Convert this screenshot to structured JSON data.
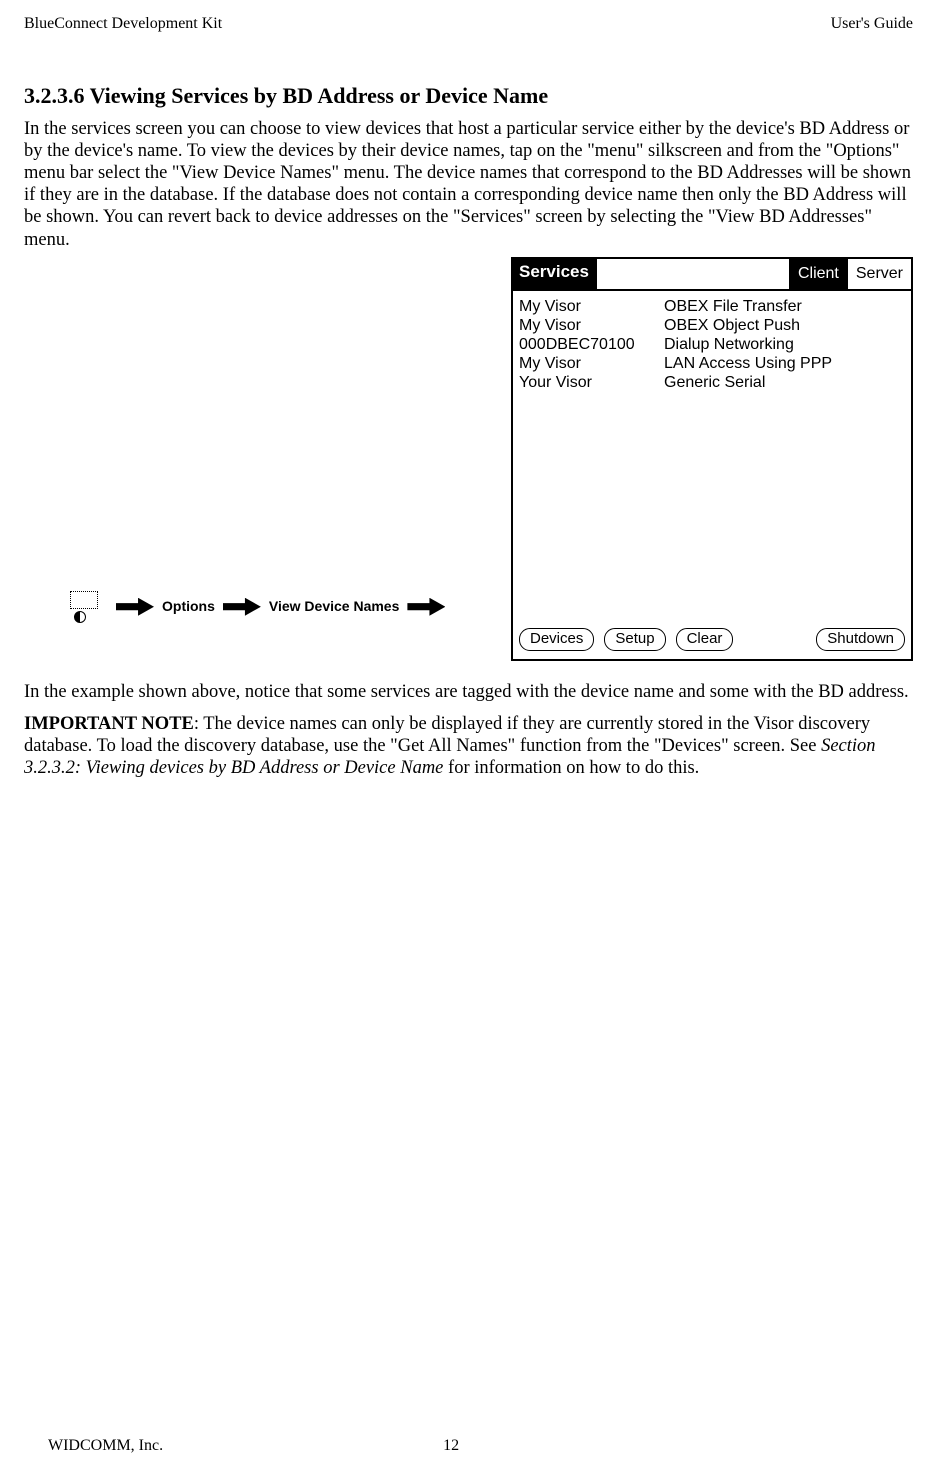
{
  "doc": {
    "header_left": "BlueConnect Development Kit",
    "header_right": "User's Guide",
    "footer_left": "WIDCOMM, Inc.",
    "footer_page": "12"
  },
  "section": {
    "number": "3.2.3.6",
    "title": "Viewing Services by BD Address or Device Name",
    "para1": "In the services screen you can choose to view devices that host a particular service either by the device's BD Address or by the device's name. To view the devices by their device names, tap on the \"menu\" silkscreen and from the \"Options\" menu bar select the \"View Device Names\" menu. The device names that correspond to the BD Addresses will be shown if they are in the database. If the database does not contain a corresponding device name then only the BD Address will be shown. You can revert back to device addresses on the \"Services\" screen by selecting the \"View BD Addresses\" menu.",
    "para2": "In the example shown above, notice that some services are tagged with the device name and some with the BD address.",
    "note_label": "IMPORTANT NOTE",
    "note_body_a": ":  The device names can only be displayed if they are currently stored in the Visor discovery database.  To load the discovery database, use the \"Get All Names\" function from the \"Devices\" screen.  See ",
    "note_italic": "Section 3.2.3.2: Viewing devices by BD Address or Device Name",
    "note_body_b": " for information on how to do this."
  },
  "menu_path": {
    "step1": "Options",
    "step2": "View Device Names"
  },
  "pda": {
    "title": "Services",
    "tab_client": "Client",
    "tab_server": "Server",
    "rows": [
      {
        "dev": "My Visor",
        "svc": "OBEX File Transfer"
      },
      {
        "dev": "My Visor",
        "svc": "OBEX Object Push"
      },
      {
        "dev": "000DBEC70100",
        "svc": "Dialup Networking"
      },
      {
        "dev": "My Visor",
        "svc": "LAN Access Using PPP"
      },
      {
        "dev": "Your Visor",
        "svc": "Generic Serial"
      }
    ],
    "buttons": {
      "devices": "Devices",
      "setup": "Setup",
      "clear": "Clear",
      "shutdown": "Shutdown"
    }
  }
}
